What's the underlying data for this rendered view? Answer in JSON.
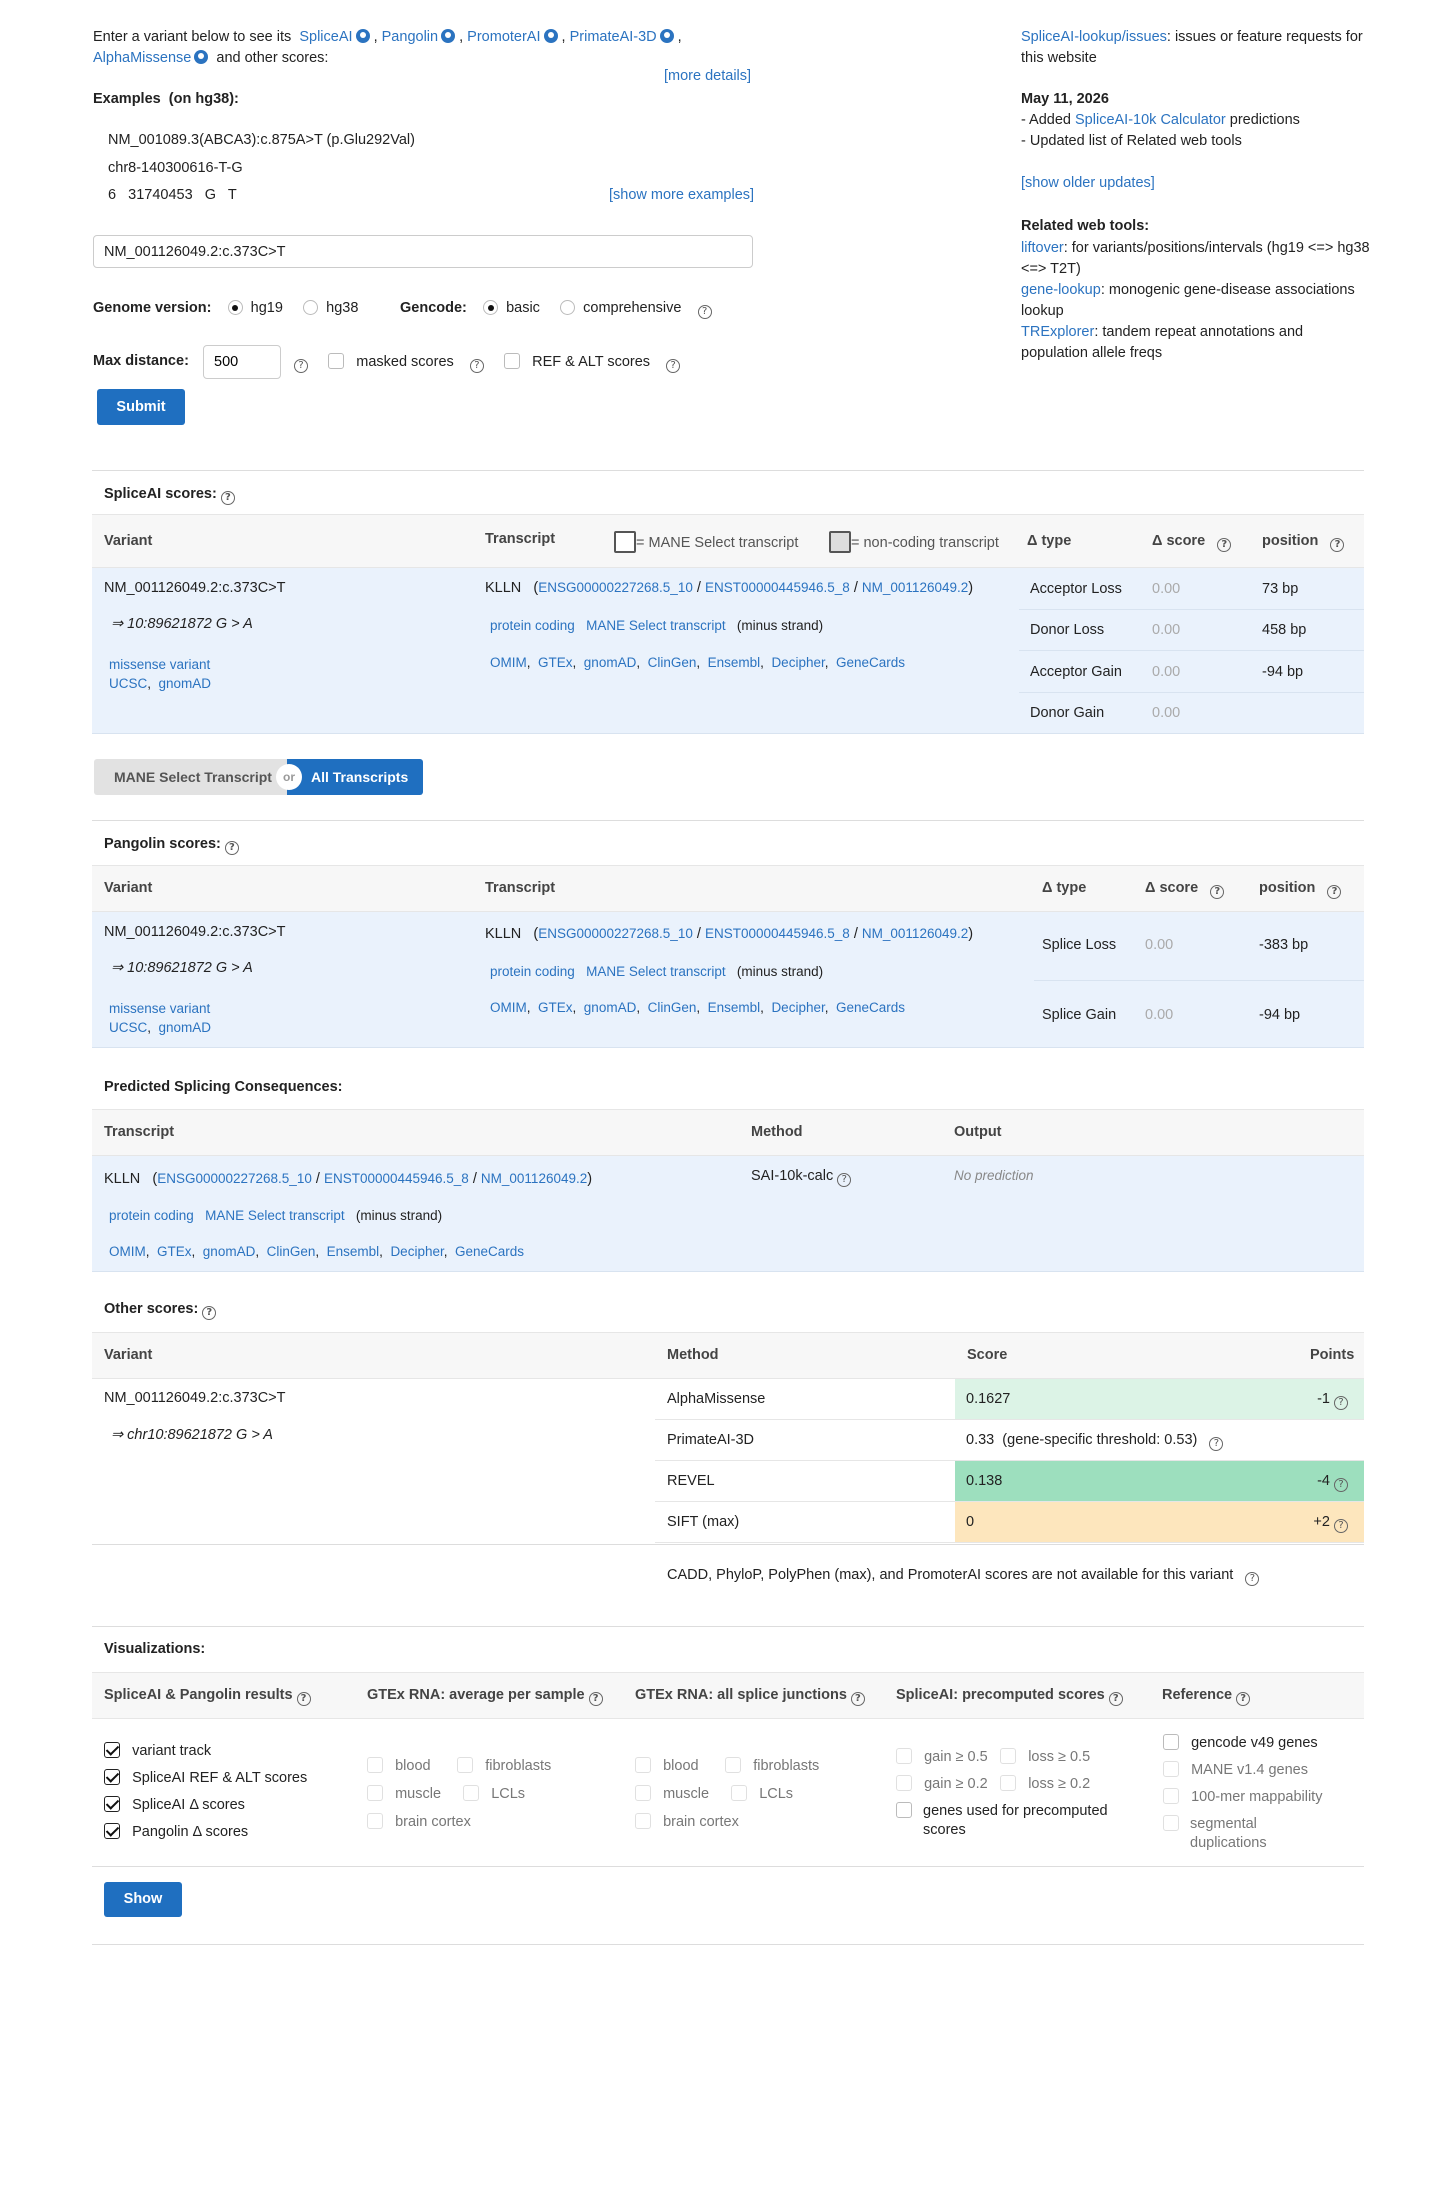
{
  "intro": {
    "text_prefix": "Enter a variant below to see its",
    "tools": [
      "SpliceAI",
      "Pangolin",
      "PromoterAI",
      "PrimateAI-3D",
      "AlphaMissense"
    ],
    "text_suffix": "and other scores:",
    "more_details": "[more details]"
  },
  "examples": {
    "title": "Examples",
    "build": "(on hg38):",
    "items": [
      "NM_001089.3(ABCA3):c.875A>T (p.Glu292Val)",
      "chr8-140300616-T-G",
      "6   31740453   G   T"
    ],
    "show_more": "[show more examples]"
  },
  "search": {
    "value": "NM_001126049.2:c.373C>T"
  },
  "options": {
    "genome_label": "Genome version:",
    "genome_options": [
      "hg19",
      "hg38"
    ],
    "genome_selected": "hg19",
    "gencode_label": "Gencode:",
    "gencode_options": [
      "basic",
      "comprehensive"
    ],
    "gencode_selected": "basic",
    "maxdist_label": "Max distance:",
    "maxdist_value": "500",
    "masked_label": "masked scores",
    "refalt_label": "REF & ALT scores",
    "submit": "Submit"
  },
  "sidebar": {
    "issues_link": "SpliceAI-lookup/issues",
    "issues_text": ": issues or feature requests for this website",
    "update_date": "May 11, 2026",
    "update_1_prefix": "- Added ",
    "update_1_link": "SpliceAI-10k Calculator",
    "update_1_suffix": " predictions",
    "update_2": "- Updated list of Related web tools",
    "show_older": "[show older updates]",
    "related_title": "Related web tools:",
    "tools": [
      {
        "name": "liftover",
        "desc": ": for variants/positions/intervals (hg19 <=> hg38 <=> T2T)"
      },
      {
        "name": "gene-lookup",
        "desc": ": monogenic gene-disease associations lookup"
      },
      {
        "name": "TRExplorer",
        "desc": ": tandem repeat annotations and population allele freqs"
      }
    ]
  },
  "variant": {
    "name": "NM_001126049.2:c.373C>T",
    "hg19_pos": "⇒ 10:89621872 G > A",
    "chr_pos": "⇒ chr10:89621872 G > A",
    "consequence": "missense variant",
    "links": [
      "UCSC",
      "gnomAD"
    ]
  },
  "transcript": {
    "gene": "KLLN",
    "ids": [
      "ENSG00000227268.5_10",
      "ENST00000445946.5_8",
      "NM_001126049.2"
    ],
    "biotype": "protein coding",
    "mane": "MANE Select transcript",
    "strand": "(minus strand)",
    "links": [
      "OMIM",
      "GTEx",
      "gnomAD",
      "ClinGen",
      "Ensembl",
      "Decipher",
      "GeneCards"
    ]
  },
  "spliceai": {
    "title": "SpliceAI scores:",
    "headers": {
      "variant": "Variant",
      "transcript": "Transcript",
      "mane_legend": "= MANE Select transcript",
      "noncoding_legend": "= non-coding transcript",
      "type": "Δ type",
      "score": "Δ score",
      "position": "position"
    },
    "rows": [
      {
        "type": "Acceptor Loss",
        "score": "0.00",
        "position": "73 bp"
      },
      {
        "type": "Donor Loss",
        "score": "0.00",
        "position": "458 bp"
      },
      {
        "type": "Acceptor Gain",
        "score": "0.00",
        "position": "-94 bp"
      },
      {
        "type": "Donor Gain",
        "score": "0.00",
        "position": ""
      }
    ]
  },
  "toggle": {
    "left": "MANE Select Transcript",
    "or": "or",
    "right": "All Transcripts"
  },
  "pangolin": {
    "title": "Pangolin scores:",
    "headers": {
      "variant": "Variant",
      "transcript": "Transcript",
      "type": "Δ type",
      "score": "Δ score",
      "position": "position"
    },
    "rows": [
      {
        "type": "Splice Loss",
        "score": "0.00",
        "position": "-383 bp"
      },
      {
        "type": "Splice Gain",
        "score": "0.00",
        "position": "-94 bp"
      }
    ]
  },
  "consequences": {
    "title": "Predicted Splicing Consequences:",
    "headers": {
      "transcript": "Transcript",
      "method": "Method",
      "output": "Output"
    },
    "method": "SAI-10k-calc",
    "output": "No prediction"
  },
  "other": {
    "title": "Other scores:",
    "headers": {
      "variant": "Variant",
      "method": "Method",
      "score": "Score",
      "points": "Points"
    },
    "rows": [
      {
        "method": "AlphaMissense",
        "score": "0.1627",
        "points": "-1",
        "color": "#dcf3e6"
      },
      {
        "method": "PrimateAI-3D",
        "score": "0.33",
        "extra": "(gene-specific threshold: 0.53)",
        "points": "",
        "color": "#ffffff"
      },
      {
        "method": "REVEL",
        "score": "0.138",
        "points": "-4",
        "color": "#9ddfbe"
      },
      {
        "method": "SIFT (max)",
        "score": "0",
        "points": "+2",
        "color": "#fde6bd"
      }
    ],
    "na_note": "CADD,  PhyloP,  PolyPhen (max),  and PromoterAI scores are not available for this variant"
  },
  "viz": {
    "title": "Visualizations:",
    "col_headers": [
      "SpliceAI & Pangolin results",
      "GTEx RNA: average per sample",
      "GTEx RNA: all splice junctions",
      "SpliceAI: precomputed scores",
      "Reference"
    ],
    "col1": [
      "variant track",
      "SpliceAI REF & ALT scores",
      "SpliceAI Δ  scores",
      "Pangolin Δ  scores"
    ],
    "gtex_a": [
      "blood",
      "fibroblasts",
      "muscle",
      "LCLs",
      "brain cortex"
    ],
    "precomputed": [
      "gain ≥ 0.5",
      "loss ≥ 0.5",
      "gain ≥ 0.2",
      "loss ≥ 0.2",
      "genes used for precomputed scores"
    ],
    "reference": [
      "gencode v49 genes",
      "MANE v1.4 genes",
      "100-mer mappability",
      "segmental duplications"
    ],
    "show": "Show"
  }
}
